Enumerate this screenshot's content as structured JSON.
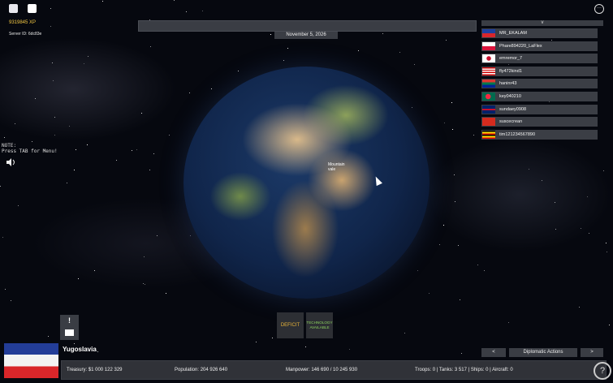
{
  "hud": {
    "xp": "9319845 XP",
    "server_id": "Server ID: 6dc83e",
    "note": "NOTE:\nPress TAB for Menu!",
    "date": "November 5, 2026",
    "more_icon": "ellipsis-icon",
    "sound_icon": "speaker-icon"
  },
  "globe": {
    "label": "Mountain\nvale"
  },
  "players": {
    "header": "v",
    "list": [
      {
        "name": "MR_EKALAM",
        "flag": "philippines-flag"
      },
      {
        "name": "Phare894220_LaFlex",
        "flag": "poland-flag"
      },
      {
        "name": "emremor_7",
        "flag": "south-korea-flag"
      },
      {
        "name": "fly472kind1",
        "flag": "malaysia-flag"
      },
      {
        "name": "haninr43",
        "flag": "south-africa-flag"
      },
      {
        "name": "key040210",
        "flag": "bangladesh-flag"
      },
      {
        "name": "sundaey0908",
        "flag": "uk-flag"
      },
      {
        "name": "suscecrean",
        "flag": "switzerland-flag"
      },
      {
        "name": "tim121234567890",
        "flag": "uganda-flag"
      }
    ]
  },
  "alerts": {
    "deficit": "DEFICIT",
    "technology": "TECHNOLOGY\nAVAILABLE",
    "alert_mark": "!"
  },
  "country": {
    "name": "Yugoslavia"
  },
  "stats": {
    "treasury": "Treasury:  $1 000 122 329",
    "population": "Population: 204 926 640",
    "manpower": "Manpower:  146 690  /  10 245 930",
    "military": "Troops: 0  |  Tanks: 3 517  |  Ships: 0  |  Aircraft: 0"
  },
  "nav": {
    "prev": "<",
    "diplomatic": "Diplomatic Actions",
    "next": ">"
  },
  "help": "?",
  "colors": {
    "xp": "#f3c742",
    "deficit": "#e9b43a",
    "tech": "#8cd35f",
    "panel": "#3a3d44"
  }
}
